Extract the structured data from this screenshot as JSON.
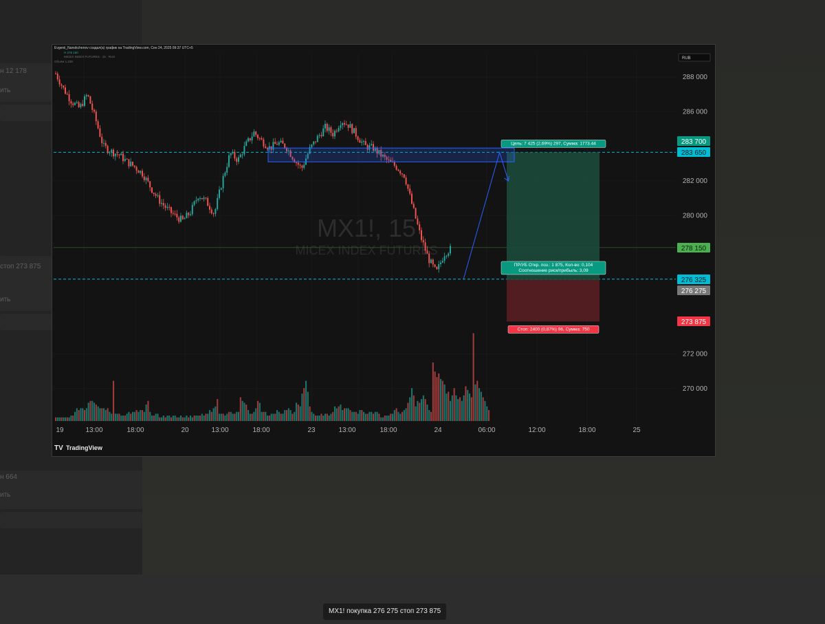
{
  "header": {
    "author_line": "Evgenii_Nanokchenov создал(а) график на TradingView.com, Сен 24, 2025 09:37 UTC+5",
    "legend_symbol": "MICEX INDEX FUTURES · 15 · RUS",
    "legend_volume": "Объём 1,33K",
    "legend_ohlc": "Н 278 150",
    "currency_badge": "RUB"
  },
  "watermark": {
    "symbol": "MX1!, 15",
    "description": "MICEX INDEX FUTURES"
  },
  "branding": {
    "logo_text": "TradingView"
  },
  "trade": {
    "target_label": "Цель: 7 425 (2,69%) 297, Сумма: 1773.44",
    "entry_line1": "ПР/УБ Откр. поз.: 1 875, Кол-во: 0,104",
    "entry_line2": "Соотношение риск/прибыль: 3,09",
    "stop_label": "Стоп: 2400 (0,87%) 96, Сумма: 750",
    "target_price": 283650,
    "entry_price": 276275,
    "stop_price": 273875
  },
  "price_tags": [
    {
      "label": "283 700",
      "bg": "#089981",
      "fg": "#ffffff",
      "value": 283700
    },
    {
      "label": "283 650",
      "bg": "#00bcd4",
      "fg": "#0b1c20",
      "value": 283650
    },
    {
      "label": "278 150",
      "bg": "#4caf50",
      "fg": "#0b200d",
      "value": 278150
    },
    {
      "label": "276 325",
      "bg": "#00bcd4",
      "fg": "#0b1c20",
      "value": 276325
    },
    {
      "label": "276 275",
      "bg": "#787878",
      "fg": "#ffffff",
      "value": 276275
    },
    {
      "label": "273 875",
      "bg": "#f23645",
      "fg": "#ffffff",
      "value": 273875
    }
  ],
  "caption": "MX1! покупка 276 275 стоп 273 875",
  "sidebar_ghost": [
    "н 12 178",
    "ить",
    "стоп 273 875",
    "ить",
    "н 664",
    "ить"
  ],
  "colors": {
    "up": "#26a69a",
    "down": "#ef5350",
    "accent": "#2962ff",
    "teal_line": "#00bcd4"
  },
  "chart_data": {
    "type": "candlestick",
    "symbol": "MX1!",
    "timeframe": "15",
    "y_ticks": [
      288000,
      286000,
      282000,
      280000,
      272000,
      270000
    ],
    "y_tick_labels": [
      "288 000",
      "286 000",
      "282 000",
      "280 000",
      "272 000",
      "270 000"
    ],
    "ylim": [
      268000,
      289000
    ],
    "x_tick_labels": [
      "19",
      "13:00",
      "18:00",
      "20",
      "13:00",
      "18:00",
      "23",
      "13:00",
      "18:00",
      "24",
      "06:00",
      "12:00",
      "18:00",
      "25"
    ],
    "volume_highlights": [
      "20 15:00",
      "24 00:30"
    ],
    "zone": {
      "upper": 283900,
      "lower": 283100
    },
    "price_path": [
      [
        0,
        288200
      ],
      [
        10,
        287300
      ],
      [
        20,
        286600
      ],
      [
        30,
        286200
      ],
      [
        40,
        287000
      ],
      [
        50,
        285600
      ],
      [
        60,
        284000
      ],
      [
        70,
        283700
      ],
      [
        80,
        283500
      ],
      [
        90,
        283100
      ],
      [
        100,
        282800
      ],
      [
        110,
        282400
      ],
      [
        120,
        281600
      ],
      [
        130,
        280900
      ],
      [
        140,
        280400
      ],
      [
        150,
        280000
      ],
      [
        160,
        279700
      ],
      [
        170,
        280200
      ],
      [
        180,
        281200
      ],
      [
        190,
        280800
      ],
      [
        200,
        280100
      ],
      [
        210,
        282000
      ],
      [
        220,
        283600
      ],
      [
        230,
        283200
      ],
      [
        240,
        284100
      ],
      [
        250,
        284800
      ],
      [
        260,
        284300
      ],
      [
        270,
        283900
      ],
      [
        280,
        284200
      ],
      [
        290,
        284000
      ],
      [
        300,
        283300
      ],
      [
        310,
        282700
      ],
      [
        320,
        283800
      ],
      [
        330,
        284500
      ],
      [
        340,
        285100
      ],
      [
        350,
        284700
      ],
      [
        360,
        285500
      ],
      [
        370,
        285200
      ],
      [
        380,
        284600
      ],
      [
        390,
        284000
      ],
      [
        400,
        283900
      ],
      [
        410,
        283500
      ],
      [
        420,
        283100
      ],
      [
        430,
        282800
      ],
      [
        440,
        282300
      ],
      [
        450,
        280500
      ],
      [
        460,
        278800
      ],
      [
        470,
        277500
      ],
      [
        480,
        276700
      ],
      [
        490,
        277800
      ],
      [
        500,
        278150
      ]
    ],
    "projection": [
      [
        515,
        276325
      ],
      [
        556,
        283650
      ],
      [
        566,
        282000
      ]
    ],
    "volume": [
      2,
      2,
      2,
      2,
      2,
      2,
      2,
      2,
      3,
      3,
      5,
      7,
      6,
      7,
      7,
      6,
      7,
      10,
      11,
      11,
      10,
      9,
      8,
      7,
      7,
      7,
      6,
      7,
      5,
      4,
      22,
      4,
      4,
      4,
      3,
      3,
      3,
      4,
      5,
      4,
      5,
      5,
      6,
      5,
      6,
      6,
      5,
      9,
      11,
      5,
      3,
      3,
      4,
      4,
      2,
      2,
      3,
      2,
      3,
      3,
      2,
      3,
      3,
      2,
      2,
      3,
      2,
      2,
      3,
      2,
      3,
      2,
      3,
      3,
      3,
      3,
      4,
      3,
      4,
      4,
      6,
      5,
      7,
      8,
      12,
      4,
      4,
      4,
      3,
      4,
      5,
      5,
      4,
      4,
      5,
      5,
      13,
      11,
      10,
      9,
      6,
      4,
      4,
      5,
      7,
      11,
      10,
      5,
      5,
      5,
      3,
      3,
      4,
      4,
      4,
      6,
      5,
      4,
      4,
      6,
      6,
      7,
      6,
      4,
      5,
      10,
      9,
      8,
      15,
      18,
      22,
      16,
      8,
      5,
      4,
      3,
      3,
      3,
      4,
      3,
      4,
      4,
      3,
      4,
      5,
      8,
      7,
      8,
      9,
      6,
      7,
      7,
      7,
      6,
      5,
      5,
      5,
      4,
      6,
      6,
      5,
      4,
      4,
      5,
      5,
      4,
      5,
      5,
      4,
      2,
      2,
      3,
      3,
      3,
      4,
      4,
      6,
      7,
      5,
      4,
      5,
      6,
      7,
      10,
      13,
      18,
      14,
      8,
      11,
      10,
      12,
      14,
      12,
      9,
      6,
      5,
      32,
      27,
      24,
      26,
      23,
      22,
      20,
      15,
      16,
      11,
      14,
      18,
      14,
      12,
      13,
      11,
      14,
      19,
      17,
      15,
      13,
      48,
      20,
      22,
      18,
      16,
      13,
      11,
      8,
      6
    ]
  }
}
